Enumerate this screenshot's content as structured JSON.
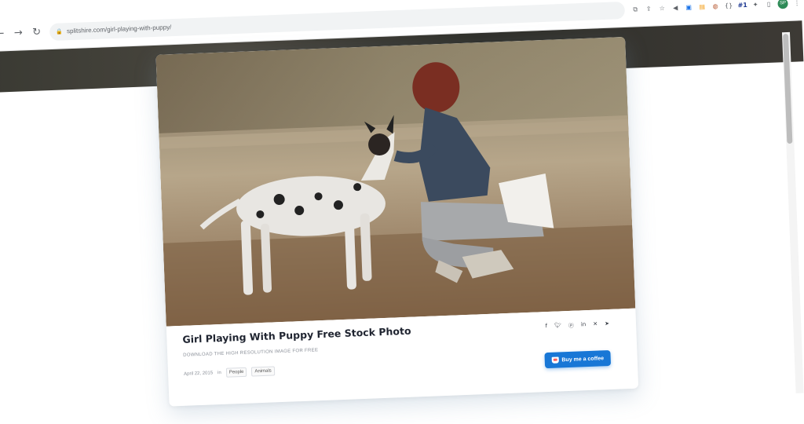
{
  "browser": {
    "url": "splitshire.com/girl-playing-with-puppy/",
    "extensions": [
      "translate-icon",
      "share-icon",
      "star-icon",
      "speaker-icon",
      "cast-icon",
      "pdf-icon",
      "stack-icon",
      "rss-icon",
      "braces-icon",
      "badge-1-icon",
      "puzzle-icon",
      "panel-icon"
    ],
    "badge_text": "#1",
    "profile_initials": "SP"
  },
  "article": {
    "title": "Girl Playing With Puppy Free Stock Photo",
    "subtitle": "DOWNLOAD THE HIGH RESOLUTION IMAGE FOR FREE",
    "date": "April 22, 2015",
    "in_label": "in",
    "tags": [
      "People",
      "Animals"
    ],
    "share_icons": [
      "facebook-icon",
      "twitter-icon",
      "pinterest-icon",
      "linkedin-icon",
      "xing-icon",
      "telegram-icon"
    ],
    "coffee_label": "Buy me a coffee"
  },
  "colors": {
    "accent": "#1877d6",
    "title": "#1f2430",
    "meta": "#8a8f98"
  }
}
